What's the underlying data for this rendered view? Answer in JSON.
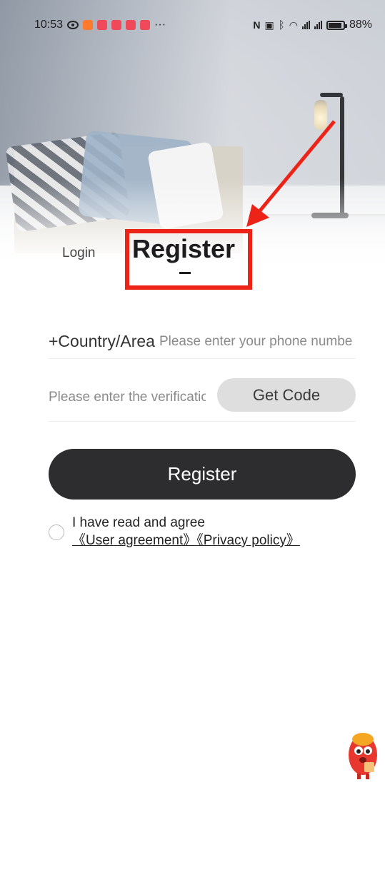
{
  "status_bar": {
    "time": "10:53",
    "battery": "88%",
    "more": "···"
  },
  "tabs": {
    "login": "Login",
    "register": "Register"
  },
  "form": {
    "country_label": "+Country/Area",
    "phone_placeholder": "Please enter your phone number",
    "code_placeholder": "Please enter the verification code",
    "get_code": "Get Code",
    "submit": "Register"
  },
  "agreement": {
    "prefix": "I have read and agree",
    "user_agreement": "《User agreement》",
    "privacy_policy": "《Privacy policy》"
  },
  "colors": {
    "annotation": "#ee2318",
    "primary_button": "#2d2d2f",
    "get_code_button": "#dedede"
  },
  "icons": [
    "eye-icon",
    "bluetooth-icon",
    "wifi-icon",
    "signal-icon",
    "battery-icon",
    "mascot-icon"
  ]
}
